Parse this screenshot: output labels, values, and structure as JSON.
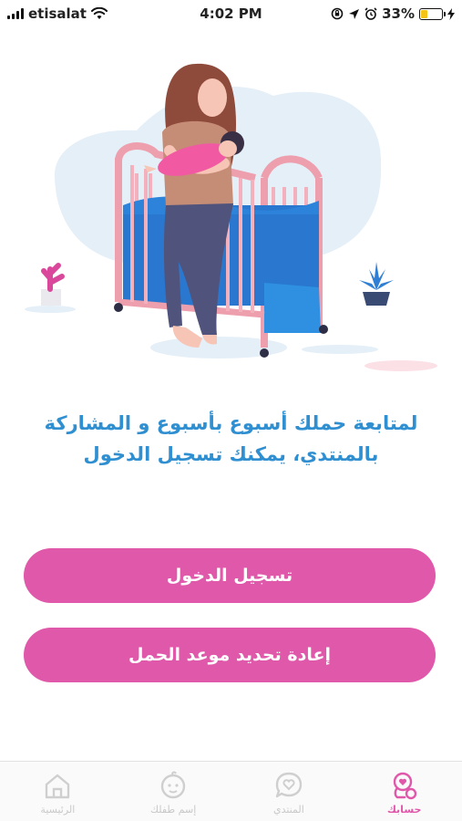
{
  "status_bar": {
    "carrier": "etisalat",
    "time": "4:02 PM",
    "battery": "33%",
    "battery_level": 0.33
  },
  "illustration": {
    "icon": "mother-baby-crib-illustration"
  },
  "message": {
    "line1": "لمتابعة حملك أسبوع بأسبوع و المشاركة",
    "line2": "بالمنتدي، يمكنك تسجيل الدخول"
  },
  "buttons": {
    "login": "تسجيل الدخول",
    "reset_due_date": "إعادة تحديد موعد الحمل"
  },
  "tabbar": {
    "items": [
      {
        "label": "الرئيسية",
        "icon": "home-icon"
      },
      {
        "label": "إسم طفلك",
        "icon": "baby-face-icon"
      },
      {
        "label": "المنتدي",
        "icon": "chat-heart-icon"
      },
      {
        "label": "حسابك",
        "icon": "account-icon"
      }
    ],
    "active_index": 3
  },
  "colors": {
    "accent": "#e058aa",
    "message": "#2f8fd1",
    "inactive": "#c9c9c9"
  }
}
